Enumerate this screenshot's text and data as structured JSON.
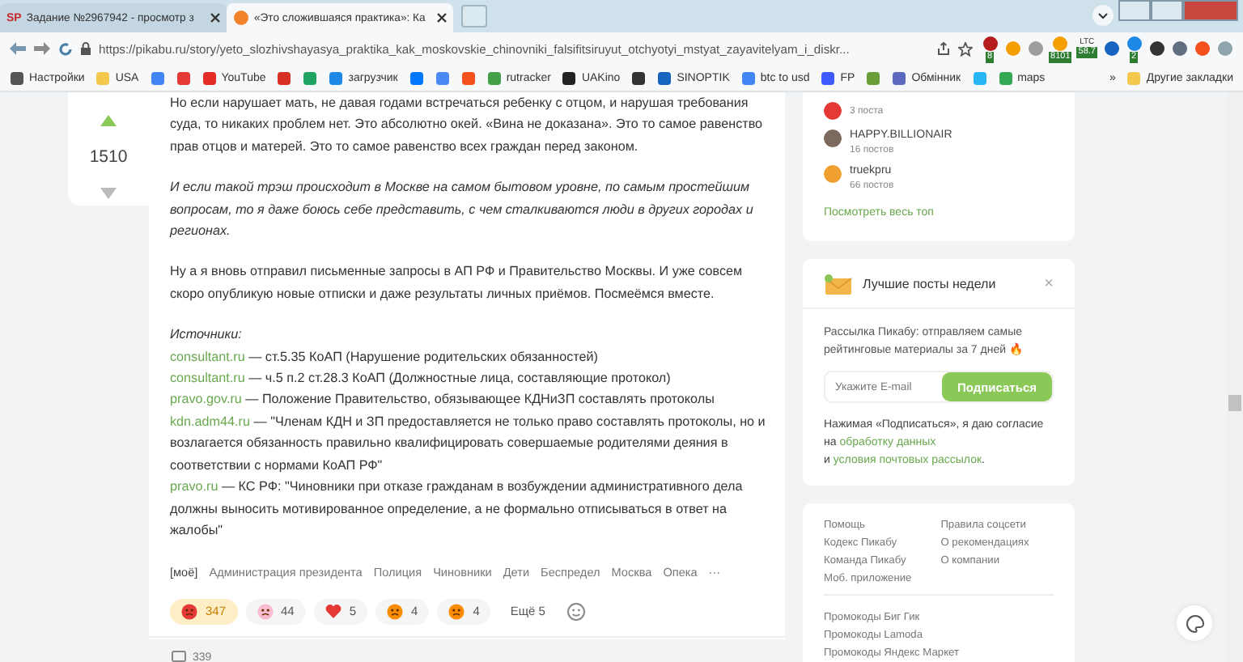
{
  "browser": {
    "tabs": [
      {
        "kind": "sp",
        "favicon_text": "SP",
        "title": "Задание №2967942 - просмотр з",
        "selected": false
      },
      {
        "kind": "pikabu",
        "title": "«Это сложившаяся практика»: Ка",
        "selected": true
      }
    ],
    "url": "https://pikabu.ru/story/yeto_slozhivshayasya_praktika_kak_moskovskie_chinovniki_falsifitsiruyut_otchyotyi_mstyat_zayavitelyam_i_diskr...",
    "extensions": [
      {
        "kind": "shield",
        "badge": "8"
      },
      {
        "kind": "coin"
      },
      {
        "kind": "box"
      },
      {
        "kind": "ticker",
        "badge": "8101"
      },
      {
        "kind": "ltc",
        "top": "LTC",
        "badge": "58.7"
      },
      {
        "kind": "v"
      },
      {
        "kind": "download",
        "badge": "2"
      },
      {
        "kind": "dark"
      },
      {
        "kind": "puzzle"
      },
      {
        "kind": "profile"
      },
      {
        "kind": "globe"
      }
    ],
    "bookmarks": [
      {
        "kind": "gear",
        "label": "Настройки"
      },
      {
        "kind": "folder",
        "label": "USA"
      },
      {
        "kind": "g"
      },
      {
        "kind": "ya"
      },
      {
        "kind": "youtube",
        "label": "YouTube"
      },
      {
        "kind": "mail"
      },
      {
        "kind": "drive"
      },
      {
        "kind": "loop",
        "label": "загрузчик"
      },
      {
        "kind": "vk"
      },
      {
        "kind": "translate"
      },
      {
        "kind": "f"
      },
      {
        "kind": "leaf",
        "label": "rutracker"
      },
      {
        "kind": "dark",
        "label": "UAKino"
      },
      {
        "kind": "chess"
      },
      {
        "kind": "thermo",
        "label": "SINOPTIK"
      },
      {
        "kind": "g",
        "label": "btc to usd"
      },
      {
        "kind": "arrow",
        "label": "FP"
      },
      {
        "kind": "sq"
      },
      {
        "kind": "eye",
        "label": "Обмінник"
      },
      {
        "kind": "star"
      },
      {
        "kind": "pin",
        "label": "maps"
      }
    ],
    "bookmarks_more": "»",
    "other_bookmarks": "Другие закладки"
  },
  "vote": {
    "rating": "1510"
  },
  "article": {
    "paragraphs": [
      {
        "kind": "plain",
        "text": "Но если нарушает мать, не давая годами встречаться ребенку с отцом, и нарушая требования суда, то никаких проблем нет. Это абсолютно окей. «Вина не доказана». Это то самое равенство прав отцов и матерей. Это то самое равенство всех граждан перед законом."
      },
      {
        "kind": "italic",
        "text": "И если такой трэш происходит в Москве на самом бытовом уровне, по самым простейшим вопросам, то я даже боюсь себе представить, с чем сталкиваются люди в других городах и регионах."
      },
      {
        "kind": "plain",
        "text": "Ну а я вновь отправил письменные запросы в АП РФ и Правительство Москвы. И уже совсем скоро опубликую новые отписки и даже результаты личных приёмов. Посмеёмся вместе."
      }
    ],
    "sources_title": "Источники:",
    "sources": [
      {
        "link": "consultant.ru",
        "text": "— ст.5.35 КоАП (Нарушение родительских обязанностей)"
      },
      {
        "link": "consultant.ru",
        "text": "— ч.5 п.2 ст.28.3 КоАП (Должностные лица, составляющие протокол)"
      },
      {
        "link": "pravo.gov.ru",
        "text": "— Положение Правительство, обязывающее КДНиЗП составлять протоколы"
      },
      {
        "link": "kdn.adm44.ru",
        "text": "— \"Членам КДН и ЗП предоставляется не только право составлять протоколы, но и возлагается обязанность правильно квалифицировать совершаемые родителями деяния в соответствии с нормами КоАП РФ\""
      },
      {
        "link": "pravo.ru",
        "text": "— КС РФ: \"Чиновники при отказе гражданам в возбуждении административного дела должны выносить мотивированное определение, а не формально отписываться в ответ на жалобы\""
      }
    ],
    "tags": [
      "[моё]",
      "Администрация президента",
      "Полиция",
      "Чиновники",
      "Дети",
      "Беспредел",
      "Москва",
      "Опека"
    ],
    "tags_more": "···",
    "reactions": [
      {
        "kind": "angry",
        "count": "347",
        "selected": true
      },
      {
        "kind": "clown",
        "count": "44",
        "selected": false
      },
      {
        "kind": "heart",
        "count": "5",
        "selected": false
      },
      {
        "kind": "wow",
        "count": "4",
        "selected": false
      },
      {
        "kind": "laugh",
        "count": "4",
        "selected": false
      }
    ],
    "more_reactions": "Ещё 5",
    "comments_count": "339"
  },
  "sidebar": {
    "authors": [
      {
        "kind": "red",
        "posts": "3 поста"
      },
      {
        "kind": "photo",
        "name": "HAPPY.BILLIONAIR",
        "posts": "16 постов"
      },
      {
        "kind": "logo",
        "name": "truekpru",
        "posts": "66 постов"
      }
    ],
    "see_all": "Посмотреть весь топ",
    "newsletter": {
      "title": "Лучшие посты недели",
      "close": "×",
      "text": "Рассылка Пикабу: отправляем самые рейтинговые материалы за 7 дней 🔥",
      "placeholder": "Укажите E-mail",
      "button": "Подписаться",
      "consent_before": "Нажимая «Подписаться», я даю согласие на",
      "consent_link1": "обработку данных",
      "consent_middle": "и",
      "consent_link2": "условия почтовых рассылок",
      "consent_end": "."
    },
    "footer_links_left": [
      "Помощь",
      "Кодекс Пикабу",
      "Команда Пикабу",
      "Моб. приложение"
    ],
    "footer_links_right": [
      "Правила соцсети",
      "О рекомендациях",
      "О компании"
    ],
    "promo_links": [
      "Промокоды Биг Гик",
      "Промокоды Lamoda",
      "Промокоды Яндекс Маркет"
    ]
  }
}
